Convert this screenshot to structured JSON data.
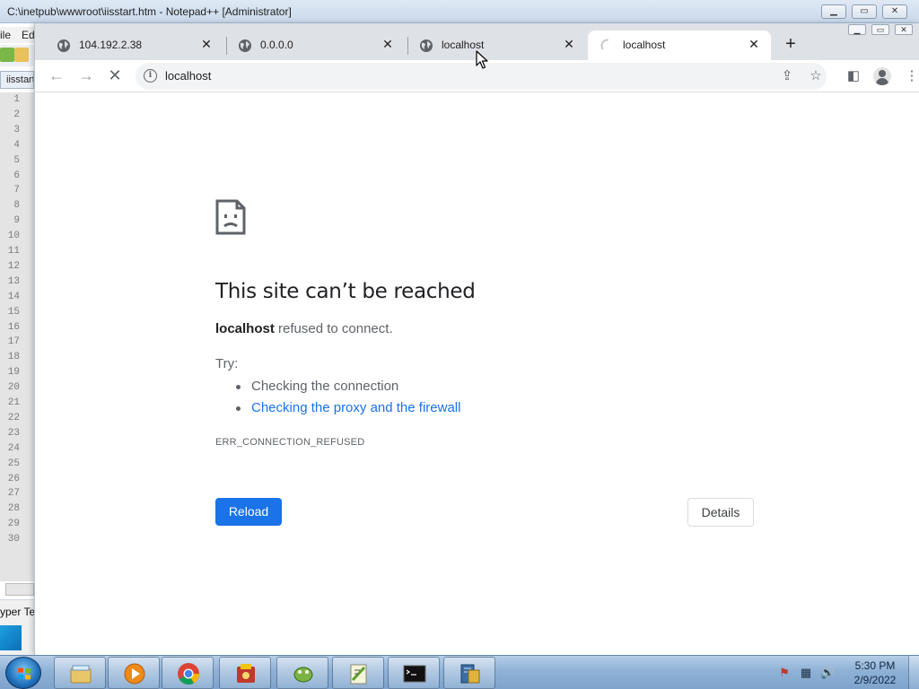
{
  "notepad": {
    "title": "C:\\inetpub\\wwwroot\\iisstart.htm - Notepad++ [Administrator]",
    "menu_file": "ile",
    "menu_edit": "Ed",
    "tab_label": "iisstart",
    "doc_type": "yper Te",
    "line_numbers": [
      "1",
      "2",
      "3",
      "4",
      "5",
      "6",
      "7",
      "8",
      "9",
      "10",
      "11",
      "12",
      "13",
      "14",
      "15",
      "16",
      "17",
      "18",
      "19",
      "20",
      "21",
      "22",
      "23",
      "24",
      "25",
      "26",
      "27",
      "28",
      "29",
      "30"
    ]
  },
  "chrome": {
    "tabs": [
      {
        "title": "104.192.2.38",
        "icon": "globe-icon",
        "active": false
      },
      {
        "title": "0.0.0.0",
        "icon": "globe-icon",
        "active": false
      },
      {
        "title": "localhost",
        "icon": "globe-icon",
        "active": false
      },
      {
        "title": "localhost",
        "icon": "loading-spinner-icon",
        "active": true
      }
    ],
    "new_tab_symbol": "+",
    "address": "localhost"
  },
  "error_page": {
    "title": "This site can’t be reached",
    "host": "localhost",
    "summary_rest": " refused to connect.",
    "try_label": "Try:",
    "suggestions": [
      "Checking the connection",
      "Checking the proxy and the firewall"
    ],
    "error_code": "ERR_CONNECTION_REFUSED",
    "reload_label": "Reload",
    "details_label": "Details"
  },
  "taskbar": {
    "apps": [
      "file-explorer-icon",
      "media-player-icon",
      "chrome-icon",
      "app-icon",
      "gecko-icon",
      "notepadpp-icon",
      "cmd-icon",
      "server-manager-icon"
    ],
    "time": "5:30 PM",
    "date": "2/9/2022"
  },
  "colors": {
    "accent": "#1a73e8",
    "tabstrip": "#dee1e6",
    "taskbar": "#8fb1d6"
  }
}
